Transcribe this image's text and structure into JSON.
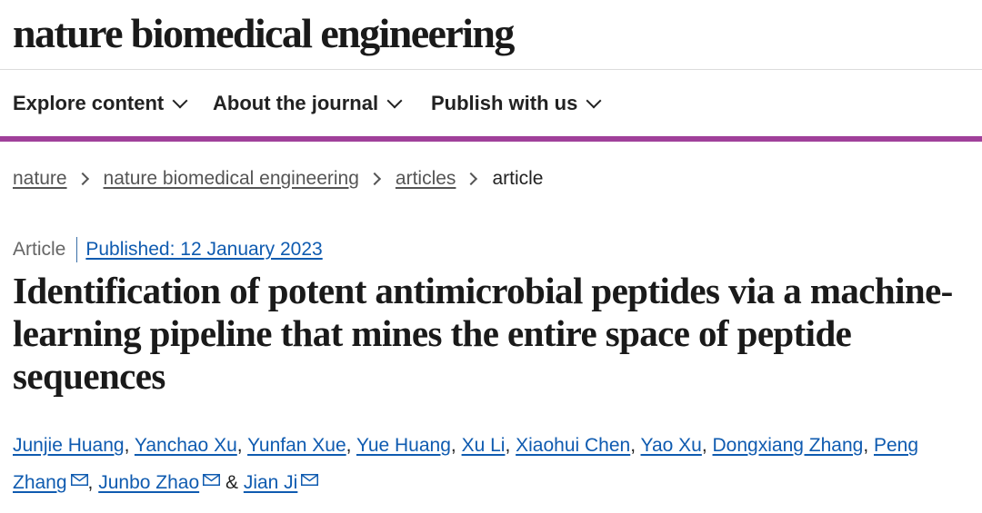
{
  "site": {
    "logo": "nature biomedical engineering"
  },
  "nav": {
    "items": [
      {
        "label": "Explore content",
        "icon": "chevron-down-icon"
      },
      {
        "label": "About the journal",
        "icon": "chevron-down-icon"
      },
      {
        "label": "Publish with us",
        "icon": "chevron-down-icon"
      }
    ]
  },
  "accent_color": "#a0409a",
  "breadcrumb": {
    "items": [
      "nature",
      "nature biomedical engineering",
      "articles"
    ],
    "current": "article",
    "separator_icon": "chevron-right-icon"
  },
  "article": {
    "type": "Article",
    "published": "Published: 12 January 2023",
    "title": "Identification of potent antimicrobial peptides via a machine-learning pipeline that mines the entire space of peptide sequences",
    "authors": [
      "Junjie Huang",
      "Yanchao Xu",
      "Yunfan Xue",
      "Yue Huang",
      "Xu Li",
      "Xiaohui Chen",
      "Yao Xu",
      "Dongxiang Zhang",
      "Peng Zhang",
      "Junbo Zhao",
      "Jian Ji"
    ],
    "author_separator": ",",
    "author_conjunction": "&",
    "corresponding_icon": "envelope-icon",
    "link_color": "#0f5bb0"
  }
}
